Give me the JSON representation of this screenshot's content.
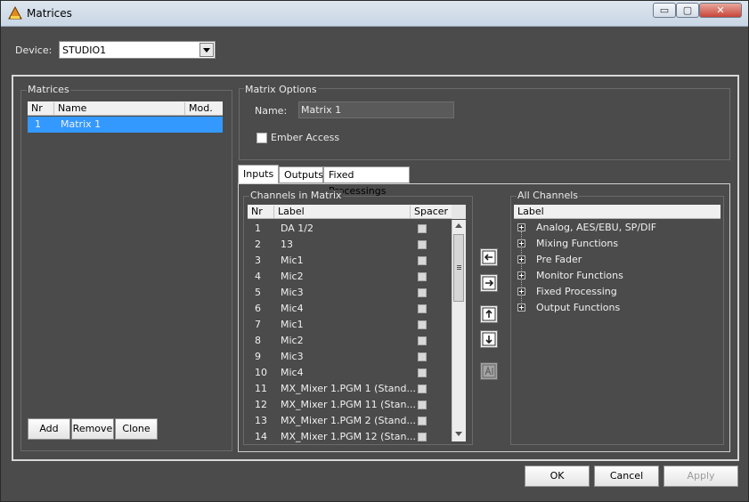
{
  "window": {
    "title": "Matrices",
    "controls": {
      "minimize": "▭",
      "maximize": "▢",
      "close": "✕"
    }
  },
  "device": {
    "label": "Device:",
    "value": "STUDIO1"
  },
  "matrices": {
    "title": "Matrices",
    "columns": [
      "Nr",
      "Name",
      "Mod."
    ],
    "rows": [
      {
        "nr": "1",
        "name": "Matrix 1",
        "mod": ""
      }
    ],
    "buttons": {
      "add": "Add",
      "remove": "Remove",
      "clone": "Clone"
    }
  },
  "options": {
    "title": "Matrix Options",
    "name_label": "Name:",
    "name_value": "Matrix 1",
    "ember_label": "Ember Access"
  },
  "tabs": [
    "Inputs",
    "Outputs",
    "Fixed Processings"
  ],
  "channels": {
    "title": "Channels in Matrix",
    "columns": [
      "Nr",
      "Label",
      "Spacer"
    ],
    "rows": [
      {
        "nr": "1",
        "label": "DA 1/2"
      },
      {
        "nr": "2",
        "label": "13"
      },
      {
        "nr": "3",
        "label": "Mic1"
      },
      {
        "nr": "4",
        "label": "Mic2"
      },
      {
        "nr": "5",
        "label": "Mic3"
      },
      {
        "nr": "6",
        "label": "Mic4"
      },
      {
        "nr": "7",
        "label": "Mic1"
      },
      {
        "nr": "8",
        "label": "Mic2"
      },
      {
        "nr": "9",
        "label": "Mic3"
      },
      {
        "nr": "10",
        "label": "Mic4"
      },
      {
        "nr": "11",
        "label": "MX_Mixer 1.PGM 1 (Stand..."
      },
      {
        "nr": "12",
        "label": "MX_Mixer 1.PGM 11 (Stan..."
      },
      {
        "nr": "13",
        "label": "MX_Mixer 1.PGM 2 (Stand..."
      },
      {
        "nr": "14",
        "label": "MX_Mixer 1.PGM 12 (Stan..."
      }
    ]
  },
  "all_channels": {
    "title": "All Channels",
    "column": "Label",
    "items": [
      "Analog, AES/EBU, SP/DIF",
      "Mixing Functions",
      "Pre Fader",
      "Monitor Functions",
      "Fixed Processing",
      "Output Functions"
    ]
  },
  "footer": {
    "ok": "OK",
    "cancel": "Cancel",
    "apply": "Apply"
  }
}
